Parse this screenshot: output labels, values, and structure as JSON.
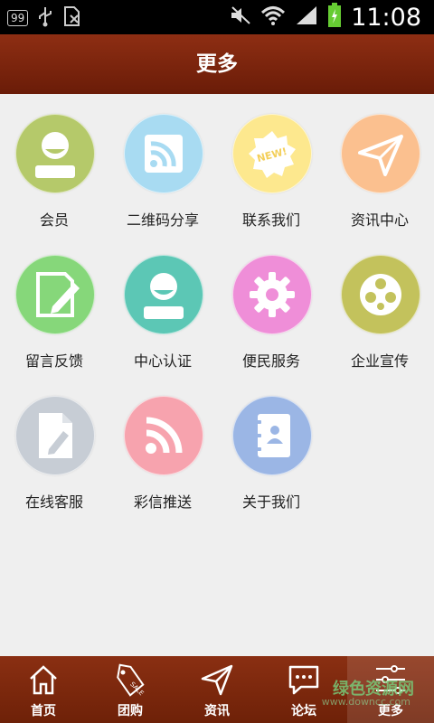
{
  "status_bar": {
    "notification_count": "99",
    "time": "11:08"
  },
  "header": {
    "title": "更多"
  },
  "grid": {
    "items": [
      {
        "label": "会员",
        "icon": "member-icon",
        "color": "#b5c96a"
      },
      {
        "label": "二维码分享",
        "icon": "rss-icon",
        "color": "#a8dbf2"
      },
      {
        "label": "联系我们",
        "icon": "new-badge-icon",
        "color": "#fde88e"
      },
      {
        "label": "资讯中心",
        "icon": "paper-plane-icon",
        "color": "#fbc08f"
      },
      {
        "label": "留言反馈",
        "icon": "edit-icon",
        "color": "#86d77a"
      },
      {
        "label": "中心认证",
        "icon": "user-icon",
        "color": "#5cc7b5"
      },
      {
        "label": "便民服务",
        "icon": "gear-icon",
        "color": "#ef8ed8"
      },
      {
        "label": "企业宣传",
        "icon": "film-reel-icon",
        "color": "#c3c25c"
      },
      {
        "label": "在线客服",
        "icon": "document-edit-icon",
        "color": "#c7cdd5"
      },
      {
        "label": "彩信推送",
        "icon": "broadcast-icon",
        "color": "#f7a3ae"
      },
      {
        "label": "关于我们",
        "icon": "address-book-icon",
        "color": "#9bb6e5"
      }
    ]
  },
  "bottom_nav": {
    "items": [
      {
        "label": "首页",
        "icon": "home-icon"
      },
      {
        "label": "团购",
        "icon": "sale-tag-icon"
      },
      {
        "label": "资讯",
        "icon": "paper-plane-icon"
      },
      {
        "label": "论坛",
        "icon": "chat-bubble-icon"
      },
      {
        "label": "更多",
        "icon": "settings-sliders-icon",
        "active": true
      }
    ]
  },
  "watermark": {
    "text": "绿色资源网",
    "url_text": "www.downcc.com"
  }
}
